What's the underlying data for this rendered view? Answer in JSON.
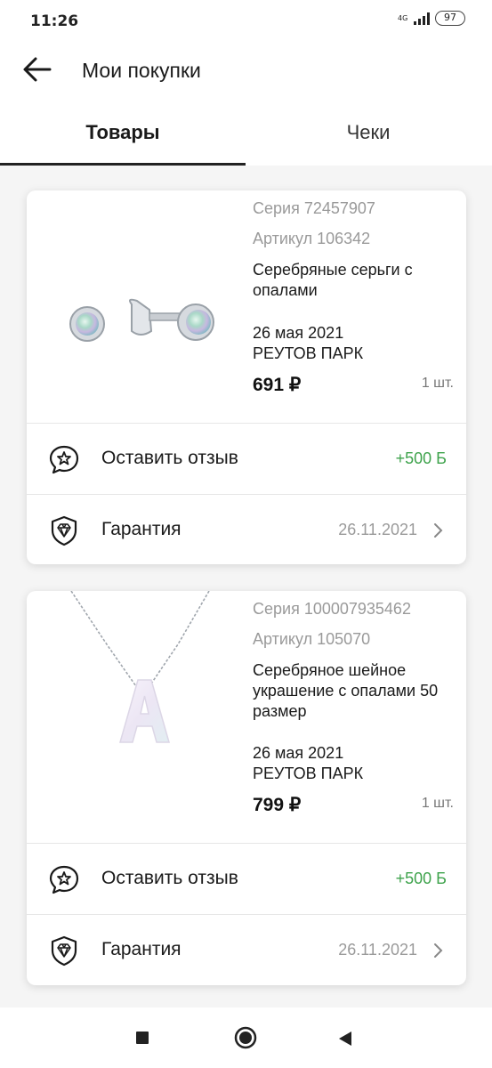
{
  "status_bar": {
    "time": "11:26",
    "network": "4G",
    "battery": "97"
  },
  "header": {
    "title": "Мои покупки"
  },
  "tabs": [
    {
      "label": "Товары",
      "active": true
    },
    {
      "label": "Чеки",
      "active": false
    }
  ],
  "products": [
    {
      "series": "Серия 72457907",
      "article": "Артикул 106342",
      "name": "Серебряные серьги с опалами",
      "date": "26 мая 2021",
      "store": "РЕУТОВ ПАРК",
      "price": "691 ₽",
      "qty": "1 шт.",
      "review_label": "Оставить отзыв",
      "review_bonus": "+500 Б",
      "warranty_label": "Гарантия",
      "warranty_date": "26.11.2021"
    },
    {
      "series": "Серия 100007935462",
      "article": "Артикул 105070",
      "name": "Серебряное шейное украшение с опалами 50 размер",
      "date": "26 мая 2021",
      "store": "РЕУТОВ ПАРК",
      "price": "799 ₽",
      "qty": "1 шт.",
      "review_label": "Оставить отзыв",
      "review_bonus": "+500 Б",
      "warranty_label": "Гарантия",
      "warranty_date": "26.11.2021"
    }
  ],
  "icons": {
    "back": "arrow-left-icon",
    "review": "star-speech-bubble-icon",
    "warranty": "diamond-shield-icon",
    "chevron": "chevron-right-icon",
    "nav_recents": "square-icon",
    "nav_home": "circle-icon",
    "nav_back": "triangle-left-icon"
  },
  "colors": {
    "bonus": "#3fa34d",
    "muted": "#9a9a9a",
    "accent": "#222222"
  }
}
